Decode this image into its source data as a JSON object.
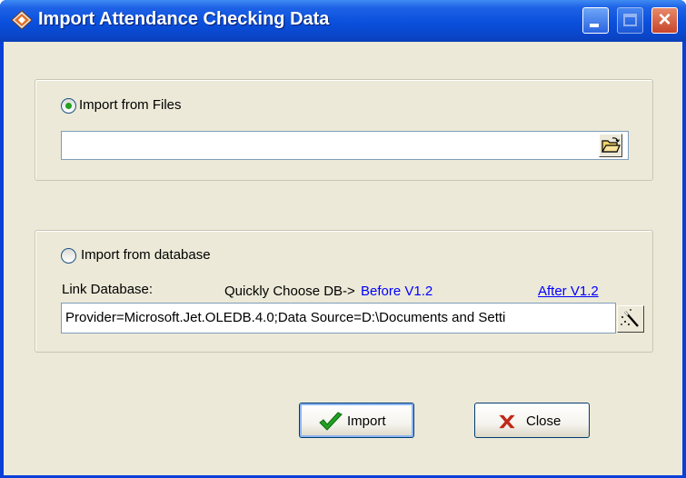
{
  "window": {
    "title": "Import Attendance Checking Data"
  },
  "files_group": {
    "option_label": "Import from Files",
    "selected": true,
    "path_value": ""
  },
  "database_group": {
    "option_label": "Import from database",
    "selected": false,
    "link_label": "Link Database:",
    "quick_choose_label": "Quickly Choose DB->",
    "before_link": "Before V1.2",
    "after_link": "After V1.2",
    "connection_string": "Provider=Microsoft.Jet.OLEDB.4.0;Data Source=D:\\Documents and Setti"
  },
  "buttons": {
    "import_label": "Import",
    "close_label": "Close"
  },
  "colors": {
    "titlebar": "#0a4fdc",
    "dialog_bg": "#ece9d8",
    "link": "#0000ff",
    "check_green": "#21a121",
    "close_x_red": "#c0281a"
  },
  "icons": [
    "app-icon",
    "minimize-icon",
    "maximize-icon",
    "close-icon",
    "open-folder-icon",
    "magic-wand-icon",
    "checkmark-icon",
    "x-mark-icon"
  ]
}
